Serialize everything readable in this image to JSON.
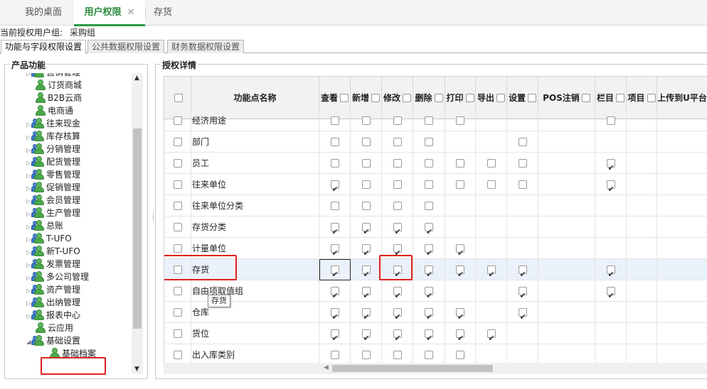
{
  "top_tabs": [
    {
      "label": "我的桌面"
    },
    {
      "label": "用户权限",
      "close": "✕"
    },
    {
      "label": "存货"
    }
  ],
  "user_group": {
    "label": "当前授权用户组:",
    "value": "采购组"
  },
  "sub_tabs": [
    {
      "label": "功能与字段权限设置"
    },
    {
      "label": "公共数据权限设置"
    },
    {
      "label": "财务数据权限设置"
    }
  ],
  "left_panel": {
    "title": "产品功能",
    "tree": [
      {
        "label": "营销管理",
        "icon": "user-group-icon",
        "expandable": true
      },
      {
        "label": "订货商城",
        "icon": "user-icon",
        "expandable": false
      },
      {
        "label": "B2B云商",
        "icon": "user-icon",
        "expandable": false
      },
      {
        "label": "电商通",
        "icon": "user-icon",
        "expandable": false
      },
      {
        "label": "往来现金",
        "icon": "user-group-icon",
        "expandable": true
      },
      {
        "label": "库存核算",
        "icon": "user-group-icon",
        "expandable": true
      },
      {
        "label": "分销管理",
        "icon": "user-group-icon",
        "expandable": true
      },
      {
        "label": "配货管理",
        "icon": "user-group-icon",
        "expandable": true
      },
      {
        "label": "零售管理",
        "icon": "user-group-icon",
        "expandable": true
      },
      {
        "label": "促销管理",
        "icon": "user-group-icon",
        "expandable": true
      },
      {
        "label": "会员管理",
        "icon": "user-group-icon",
        "expandable": true
      },
      {
        "label": "生产管理",
        "icon": "user-group-icon",
        "expandable": true
      },
      {
        "label": "总账",
        "icon": "user-group-icon",
        "expandable": true
      },
      {
        "label": "T-UFO",
        "icon": "user-group-icon",
        "expandable": true
      },
      {
        "label": "新T-UFO",
        "icon": "user-group-icon",
        "expandable": true
      },
      {
        "label": "发票管理",
        "icon": "user-group-icon",
        "expandable": true
      },
      {
        "label": "多公司管理",
        "icon": "user-group-icon",
        "expandable": true
      },
      {
        "label": "资产管理",
        "icon": "user-group-icon",
        "expandable": true
      },
      {
        "label": "出纳管理",
        "icon": "user-group-icon",
        "expandable": true
      },
      {
        "label": "报表中心",
        "icon": "user-group-icon",
        "expandable": true
      },
      {
        "label": "云应用",
        "icon": "user-icon",
        "expandable": false
      },
      {
        "label": "基础设置",
        "icon": "user-group-icon",
        "expandable": true,
        "expanded": true
      },
      {
        "label": "基础档案",
        "icon": "user-icon",
        "expandable": false,
        "selected": true,
        "child": true
      }
    ]
  },
  "right_panel": {
    "title": "授权详情",
    "columns": [
      {
        "label": "",
        "checkbox": true
      },
      {
        "label": "功能点名称",
        "checkbox": false
      },
      {
        "label": "查看",
        "checkbox": true
      },
      {
        "label": "新增",
        "checkbox": true
      },
      {
        "label": "修改",
        "checkbox": true
      },
      {
        "label": "删除",
        "checkbox": true
      },
      {
        "label": "打印",
        "checkbox": true
      },
      {
        "label": "导出",
        "checkbox": true
      },
      {
        "label": "设置",
        "checkbox": true
      },
      {
        "label": "POS注销",
        "checkbox": true
      },
      {
        "label": "栏目",
        "checkbox": true
      },
      {
        "label": "项目",
        "checkbox": true
      },
      {
        "label": "上传到U平台",
        "checkbox": false
      }
    ],
    "rows": [
      {
        "name": "经济用途",
        "cells": [
          "u",
          "u",
          "u",
          "u",
          "u",
          "",
          "",
          "",
          "u",
          "",
          ""
        ]
      },
      {
        "name": "部门",
        "cells": [
          "u",
          "u",
          "u",
          "u",
          "",
          "",
          "u",
          "",
          "",
          "",
          ""
        ]
      },
      {
        "name": "员工",
        "cells": [
          "u",
          "u",
          "u",
          "u",
          "u",
          "u",
          "u",
          "",
          "c",
          "",
          ""
        ]
      },
      {
        "name": "往来单位",
        "cells": [
          "c",
          "u",
          "u",
          "u",
          "u",
          "u",
          "u",
          "",
          "c",
          "",
          ""
        ]
      },
      {
        "name": "往来单位分类",
        "cells": [
          "u",
          "u",
          "u",
          "u",
          "",
          "",
          "",
          "",
          "",
          "",
          ""
        ]
      },
      {
        "name": "存货分类",
        "cells": [
          "c",
          "c",
          "c",
          "c",
          "",
          "",
          "",
          "",
          "",
          "",
          ""
        ]
      },
      {
        "name": "计量单位",
        "cells": [
          "c",
          "c",
          "c",
          "c",
          "c",
          "",
          "",
          "",
          "",
          "",
          ""
        ]
      },
      {
        "name": "存货",
        "cells": [
          "c",
          "c",
          "c",
          "c",
          "c",
          "c",
          "c",
          "",
          "c",
          "",
          ""
        ],
        "highlighted": true
      },
      {
        "name": "自由项取值组",
        "cells": [
          "c",
          "c",
          "c",
          "c",
          "",
          "",
          "c",
          "",
          "c",
          "",
          ""
        ]
      },
      {
        "name": "仓库",
        "cells": [
          "c",
          "c",
          "c",
          "c",
          "c",
          "",
          "c",
          "",
          "",
          "",
          ""
        ]
      },
      {
        "name": "货位",
        "cells": [
          "c",
          "c",
          "c",
          "c",
          "c",
          "c",
          "",
          "",
          "",
          "",
          ""
        ]
      },
      {
        "name": "出入库类别",
        "cells": [
          "u",
          "u",
          "u",
          "u",
          "u",
          "",
          "",
          "",
          "",
          "",
          ""
        ]
      }
    ],
    "tooltip": "存货"
  }
}
